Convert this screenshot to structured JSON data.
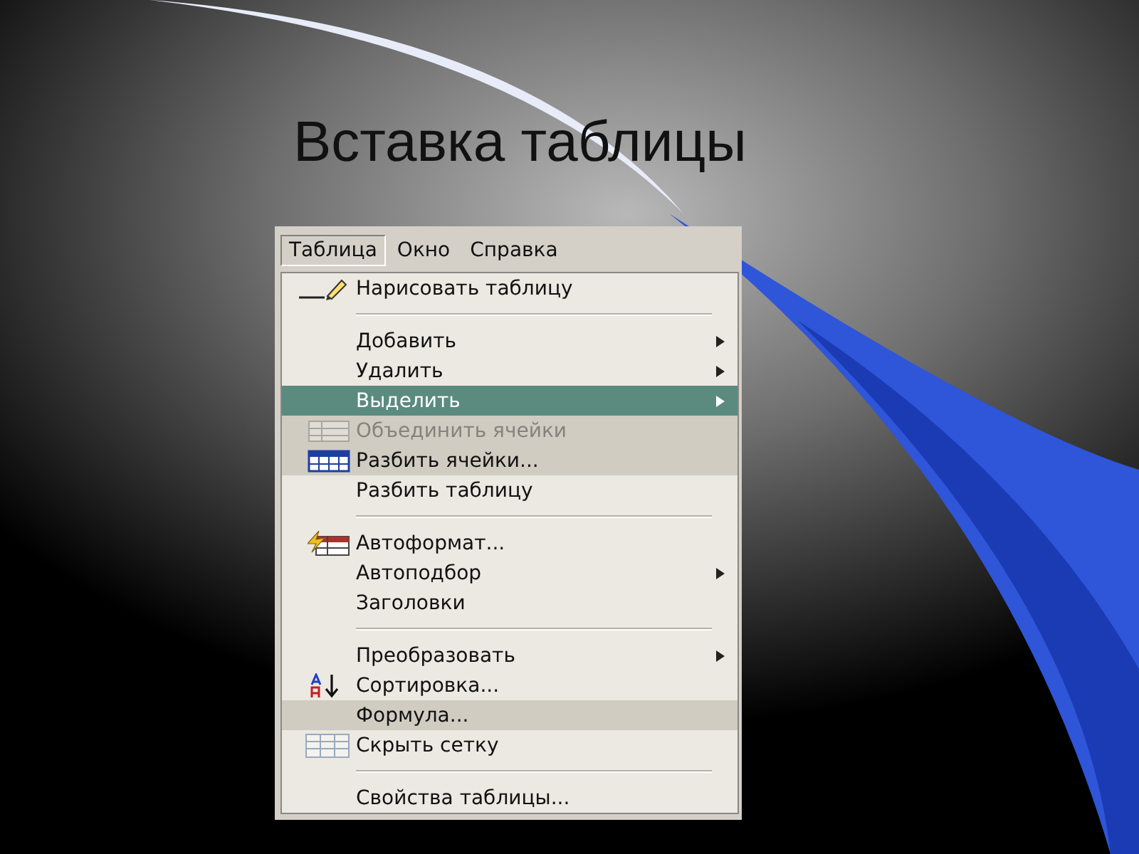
{
  "slide": {
    "title": "Вставка таблицы"
  },
  "menu_bar": [
    {
      "label": "Таблица",
      "selected": true
    },
    {
      "label": "Окно",
      "selected": false
    },
    {
      "label": "Справка",
      "selected": false
    }
  ],
  "menu": [
    {
      "kind": "item",
      "label": "Нарисовать таблицу",
      "submenu": false,
      "selected": false,
      "disabled": false,
      "rarely_used": false
    },
    {
      "kind": "separator"
    },
    {
      "kind": "item",
      "label": "Добавить",
      "submenu": true,
      "selected": false,
      "disabled": false,
      "rarely_used": false
    },
    {
      "kind": "item",
      "label": "Удалить",
      "submenu": true,
      "selected": false,
      "disabled": false,
      "rarely_used": false
    },
    {
      "kind": "item",
      "label": "Выделить",
      "submenu": true,
      "selected": true,
      "disabled": false,
      "rarely_used": false
    },
    {
      "kind": "item",
      "label": "Объединить ячейки",
      "submenu": false,
      "selected": false,
      "disabled": true,
      "rarely_used": true
    },
    {
      "kind": "item",
      "label": "Разбить ячейки...",
      "submenu": false,
      "selected": false,
      "disabled": false,
      "rarely_used": true
    },
    {
      "kind": "item",
      "label": "Разбить таблицу",
      "submenu": false,
      "selected": false,
      "disabled": false,
      "rarely_used": false
    },
    {
      "kind": "separator"
    },
    {
      "kind": "item",
      "label": "Автоформат...",
      "submenu": false,
      "selected": false,
      "disabled": false,
      "rarely_used": false
    },
    {
      "kind": "item",
      "label": "Автоподбор",
      "submenu": true,
      "selected": false,
      "disabled": false,
      "rarely_used": false
    },
    {
      "kind": "item",
      "label": "Заголовки",
      "submenu": false,
      "selected": false,
      "disabled": false,
      "rarely_used": false
    },
    {
      "kind": "separator"
    },
    {
      "kind": "item",
      "label": "Преобразовать",
      "submenu": true,
      "selected": false,
      "disabled": false,
      "rarely_used": false
    },
    {
      "kind": "item",
      "label": "Сортировка...",
      "submenu": false,
      "selected": false,
      "disabled": false,
      "rarely_used": false
    },
    {
      "kind": "item",
      "label": "Формула...",
      "submenu": false,
      "selected": false,
      "disabled": false,
      "rarely_used": true
    },
    {
      "kind": "item",
      "label": "Скрыть сетку",
      "submenu": false,
      "selected": false,
      "disabled": false,
      "rarely_used": false
    },
    {
      "kind": "separator"
    },
    {
      "kind": "item",
      "label": "Свойства таблицы...",
      "submenu": false,
      "selected": false,
      "disabled": false,
      "rarely_used": false
    }
  ]
}
